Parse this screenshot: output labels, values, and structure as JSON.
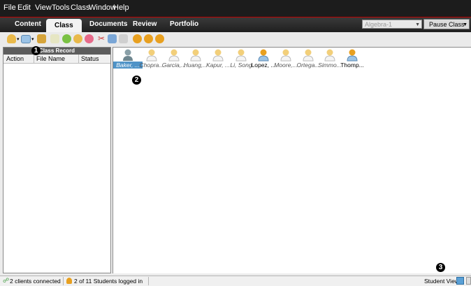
{
  "menu": [
    "File",
    "Edit",
    "View",
    "Tools",
    "Class",
    "Window",
    "Help"
  ],
  "tabs": [
    {
      "label": "Content",
      "active": false
    },
    {
      "label": "Class",
      "active": true
    },
    {
      "label": "Documents",
      "active": false
    },
    {
      "label": "Review",
      "active": false
    },
    {
      "label": "Portfolio",
      "active": false
    }
  ],
  "class_select": {
    "value": "Algebra-1"
  },
  "pause_button": {
    "label": "Pause Class"
  },
  "toolbar_icons": [
    "add-student-icon",
    "display-icon",
    "class-icon",
    "unknown-icon",
    "student-group-icon",
    "student-edit-icon",
    "student-remove-icon",
    "cut-icon",
    "copy-icon",
    "paste-icon",
    "student-a-icon",
    "student-b-icon",
    "student-c-icon"
  ],
  "class_record": {
    "title": "Class Record",
    "columns": [
      "Action",
      "File Name",
      "Status"
    ]
  },
  "students": [
    {
      "name": "Baker, ...",
      "state": "selected"
    },
    {
      "name": "Chopra...",
      "state": "offline"
    },
    {
      "name": "Garcia,...",
      "state": "offline"
    },
    {
      "name": "Huang,...",
      "state": "offline"
    },
    {
      "name": "Kapur, ...",
      "state": "offline"
    },
    {
      "name": "Li, Song",
      "state": "offline"
    },
    {
      "name": "Lopez, ...",
      "state": "loggedin"
    },
    {
      "name": "Moore,...",
      "state": "offline"
    },
    {
      "name": "Ortega...",
      "state": "offline"
    },
    {
      "name": "Simmo...",
      "state": "offline"
    },
    {
      "name": "Thomp...",
      "state": "loggedin"
    }
  ],
  "callouts": [
    "1",
    "2",
    "3"
  ],
  "status": {
    "clients": "2 clients connected",
    "logged_in": "2 of 11 Students logged in",
    "student_view": "Student View:"
  },
  "colors": {
    "accent": "#c00000",
    "selected": "#4f93c7",
    "avatar_off": "#e9b94a",
    "avatar_on": "#e8a020"
  }
}
